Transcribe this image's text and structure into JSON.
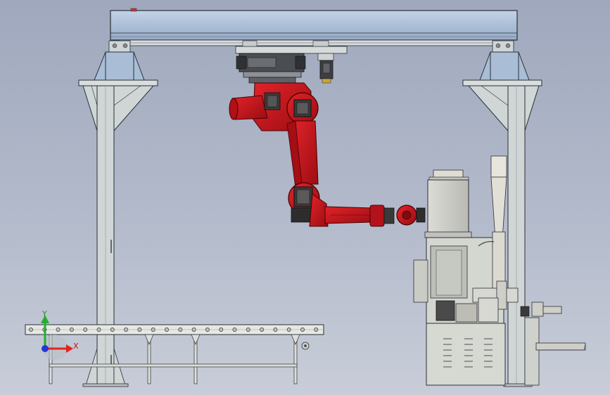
{
  "view": {
    "background_top": "#9fa8bd",
    "background_bottom": "#c8cdd8"
  },
  "colors": {
    "frame_blue": "#a9bdd6",
    "steel": "#cfd6d5",
    "robot_red": "#c8141a",
    "robot_dark": "#3a3a3a",
    "machine_gray": "#cfd2cf",
    "axis_x": "#e0241b",
    "axis_y": "#22b02e",
    "axis_z": "#2437d6"
  },
  "triad": {
    "x_label": "X",
    "y_label": "Y"
  }
}
